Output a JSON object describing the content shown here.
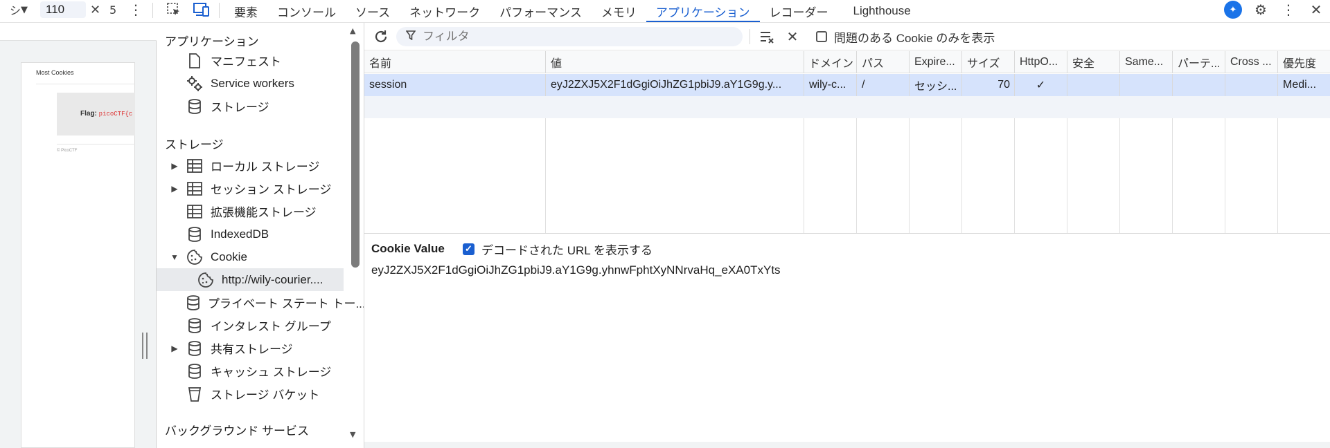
{
  "devbar": {
    "tick": "シ",
    "zoom": "110",
    "second_value": "5"
  },
  "tabs": [
    {
      "label": "要素"
    },
    {
      "label": "コンソール"
    },
    {
      "label": "ソース"
    },
    {
      "label": "ネットワーク"
    },
    {
      "label": "パフォーマンス"
    },
    {
      "label": "メモリ"
    },
    {
      "label": "アプリケーション"
    },
    {
      "label": "レコーダー"
    },
    {
      "label": "Lighthouse"
    }
  ],
  "accent": "#1a5fd0",
  "preview": {
    "title": "Most Cookies",
    "flag_label": "Flag:",
    "flag_code": "picoCTF{c",
    "footer": "© PicoCTF"
  },
  "sidebar": {
    "app_heading": "アプリケーション",
    "app_items": [
      {
        "label": "マニフェスト",
        "icon": "file-icon"
      },
      {
        "label": "Service workers",
        "icon": "gears-icon"
      },
      {
        "label": "ストレージ",
        "icon": "database-icon"
      }
    ],
    "storage_heading": "ストレージ",
    "storage_items": [
      {
        "label": "ローカル ストレージ",
        "icon": "table-icon",
        "expandable": "collapsed"
      },
      {
        "label": "セッション ストレージ",
        "icon": "table-icon",
        "expandable": "collapsed"
      },
      {
        "label": "拡張機能ストレージ",
        "icon": "table-icon"
      },
      {
        "label": "IndexedDB",
        "icon": "database-icon"
      },
      {
        "label": "Cookie",
        "icon": "cookie-icon",
        "expandable": "expanded"
      },
      {
        "label": "http://wily-courier....",
        "icon": "cookie-icon",
        "selected": true
      },
      {
        "label": "プライベート ステート トー...",
        "icon": "database-icon"
      },
      {
        "label": "インタレスト グループ",
        "icon": "database-icon"
      },
      {
        "label": "共有ストレージ",
        "icon": "database-icon",
        "expandable": "collapsed"
      },
      {
        "label": "キャッシュ ストレージ",
        "icon": "database-icon"
      },
      {
        "label": "ストレージ バケット",
        "icon": "bucket-icon"
      }
    ],
    "bg_heading": "バックグラウンド サービス"
  },
  "toolbar": {
    "filter_placeholder": "フィルタ",
    "issue_only_label": "問題のある Cookie のみを表示",
    "issue_only_checked": false
  },
  "table": {
    "columns": [
      "名前",
      "値",
      "ドメイン",
      "パス",
      "Expire...",
      "サイズ",
      "HttpO...",
      "安全",
      "Same...",
      "パーテ...",
      "Cross ...",
      "優先度"
    ],
    "rows": [
      [
        "session",
        "eyJ2ZXJ5X2F1dGgiOiJhZG1pbiJ9.aY1G9g.y...",
        "wily-c...",
        "/",
        "セッシ...",
        "70",
        "✓",
        "",
        "",
        "",
        "",
        "Medi..."
      ]
    ]
  },
  "cookie_value": {
    "label": "Cookie Value",
    "decode_label": "デコードされた URL を表示する",
    "decode_checked": true,
    "value": "eyJ2ZXJ5X2F1dGgiOiJhZG1pbiJ9.aY1G9g.yhnwFphtXyNNrvaHq_eXA0TxYts"
  }
}
